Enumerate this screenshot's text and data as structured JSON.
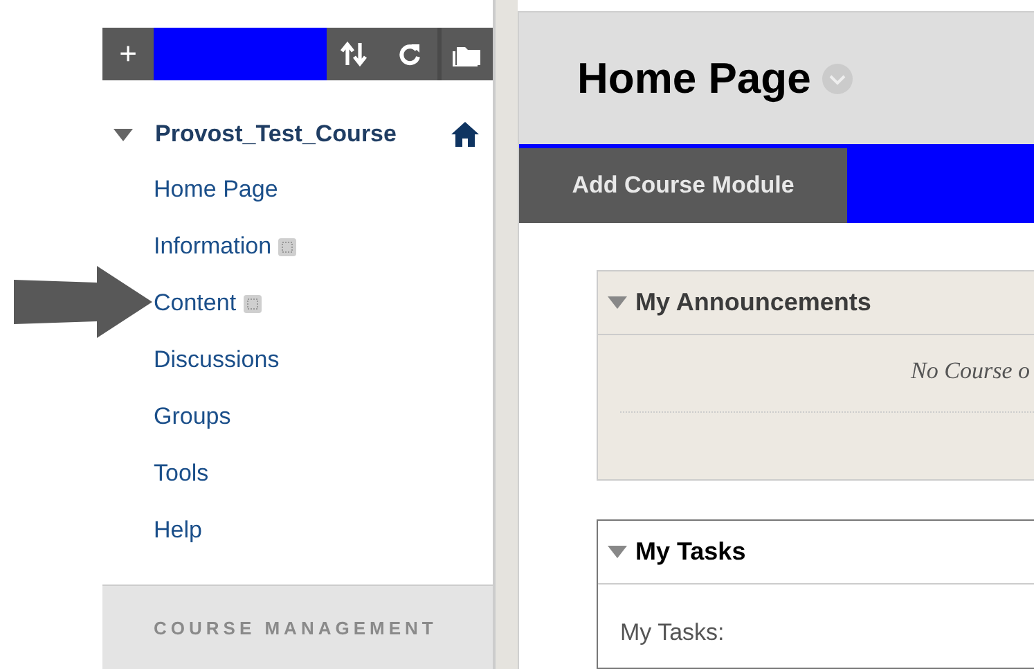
{
  "sidebar": {
    "toolbar": [
      {
        "kind": "add",
        "label": "+"
      },
      {
        "kind": "sort"
      },
      {
        "kind": "refresh"
      },
      {
        "kind": "folder"
      }
    ],
    "course": {
      "title": "Provost_Test_Course",
      "expanded": true
    },
    "items": [
      {
        "label": "Home Page",
        "hidden": false
      },
      {
        "label": "Information",
        "hidden": true
      },
      {
        "label": "Content",
        "hidden": true
      },
      {
        "label": "Discussions",
        "hidden": false
      },
      {
        "label": "Groups",
        "hidden": false
      },
      {
        "label": "Tools",
        "hidden": false
      },
      {
        "label": "Help",
        "hidden": false
      }
    ],
    "management": {
      "title": "COURSE MANAGEMENT"
    }
  },
  "main": {
    "title": "Home Page",
    "action": "Add Course Module",
    "modules": [
      {
        "title": "My Announcements",
        "kind": "announcements",
        "expanded": true,
        "text": "No Course o"
      },
      {
        "title": "My Tasks",
        "kind": "tasks",
        "expanded": true,
        "text": "My Tasks:"
      }
    ]
  },
  "annotation": {
    "kind": "arrow"
  }
}
